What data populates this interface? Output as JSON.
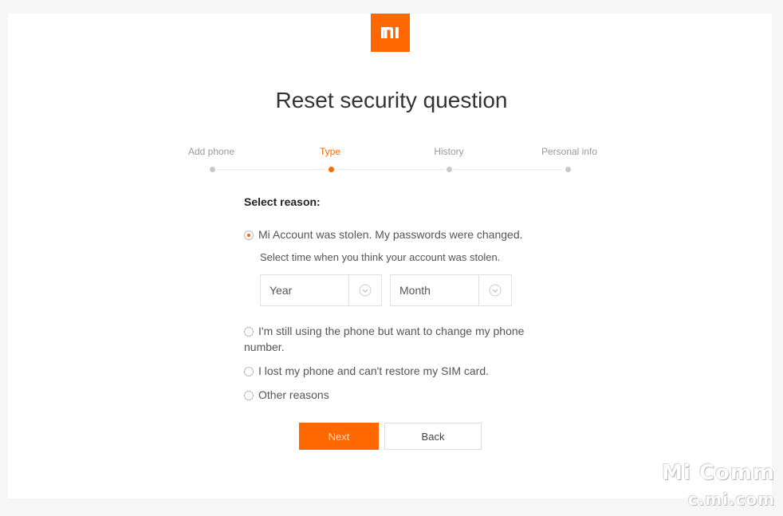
{
  "logo": {
    "text": "MI",
    "color": "#ff6700"
  },
  "page": {
    "title": "Reset security question"
  },
  "steps": [
    {
      "label": "Add phone",
      "active": false
    },
    {
      "label": "Type",
      "active": true
    },
    {
      "label": "History",
      "active": false
    },
    {
      "label": "Personal info",
      "active": false
    }
  ],
  "form": {
    "reason_title": "Select reason:",
    "options": [
      {
        "label": "Mi Account was stolen. My passwords were changed.",
        "checked": true
      },
      {
        "label": "I'm still using the phone but want to change my phone number.",
        "checked": false
      },
      {
        "label": "I lost my phone and can't restore my SIM card.",
        "checked": false
      },
      {
        "label": "Other reasons",
        "checked": false
      }
    ],
    "stolen_hint": "Select time when you think your account was stolen.",
    "year_select": {
      "value": "Year"
    },
    "month_select": {
      "value": "Month"
    }
  },
  "buttons": {
    "next": "Next",
    "back": "Back"
  },
  "watermark": {
    "line1": "Mi Comm",
    "line2": "c.mi.com"
  },
  "colors": {
    "accent": "#ff6700",
    "background": "#f6f6f6",
    "card": "#ffffff"
  }
}
